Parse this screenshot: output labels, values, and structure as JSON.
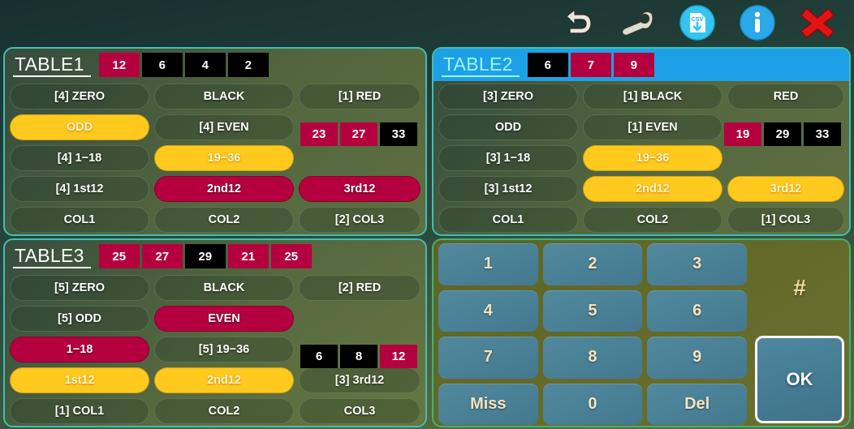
{
  "toolbar": {
    "buttons": [
      {
        "name": "undo-icon",
        "label": "Undo"
      },
      {
        "name": "wrench-icon",
        "label": "Settings"
      },
      {
        "name": "csv-export-icon",
        "label": "CSV",
        "badge": "CSV"
      },
      {
        "name": "info-icon",
        "label": "Info"
      },
      {
        "name": "close-icon",
        "label": "Close"
      }
    ]
  },
  "colors": {
    "red": "#b5003f",
    "black": "#000000",
    "yellow": "#ffc91e",
    "active_header": "#1ea0e6",
    "panel_border": "#3fbfb4",
    "key_blue": "#4a8298"
  },
  "tables": [
    {
      "id": "table1",
      "name": "TABLE1",
      "active": false,
      "history": [
        {
          "value": "12",
          "color": "red"
        },
        {
          "value": "6",
          "color": "black"
        },
        {
          "value": "4",
          "color": "black"
        },
        {
          "value": "2",
          "color": "black"
        }
      ],
      "side_chips": [
        {
          "value": "23",
          "color": "red"
        },
        {
          "value": "27",
          "color": "red"
        },
        {
          "value": "33",
          "color": "black"
        }
      ],
      "rows": [
        [
          {
            "label": "[4] ZERO",
            "state": "off"
          },
          {
            "label": "BLACK",
            "state": "off"
          },
          {
            "label": "[1] RED",
            "state": "off"
          }
        ],
        [
          {
            "label": "ODD",
            "state": "yellow"
          },
          {
            "label": "[4] EVEN",
            "state": "off"
          },
          {
            "label": "",
            "state": "blank"
          }
        ],
        [
          {
            "label": "[4] 1−18",
            "state": "off"
          },
          {
            "label": "19−36",
            "state": "yellow"
          },
          {
            "label": "",
            "state": "blank"
          }
        ],
        [
          {
            "label": "[4] 1st12",
            "state": "off"
          },
          {
            "label": "2nd12",
            "state": "red"
          },
          {
            "label": "3rd12",
            "state": "red"
          }
        ],
        [
          {
            "label": "COL1",
            "state": "off"
          },
          {
            "label": "COL2",
            "state": "off"
          },
          {
            "label": "[2] COL3",
            "state": "off"
          }
        ]
      ]
    },
    {
      "id": "table2",
      "name": "TABLE2",
      "active": true,
      "history": [
        {
          "value": "6",
          "color": "black"
        },
        {
          "value": "7",
          "color": "red"
        },
        {
          "value": "9",
          "color": "red"
        }
      ],
      "side_chips": [
        {
          "value": "19",
          "color": "red"
        },
        {
          "value": "29",
          "color": "black"
        },
        {
          "value": "33",
          "color": "black"
        }
      ],
      "rows": [
        [
          {
            "label": "[3] ZERO",
            "state": "off"
          },
          {
            "label": "[1] BLACK",
            "state": "off"
          },
          {
            "label": "RED",
            "state": "off"
          }
        ],
        [
          {
            "label": "ODD",
            "state": "off"
          },
          {
            "label": "[1] EVEN",
            "state": "off"
          },
          {
            "label": "",
            "state": "blank"
          }
        ],
        [
          {
            "label": "[3] 1−18",
            "state": "off"
          },
          {
            "label": "19−36",
            "state": "yellow"
          },
          {
            "label": "",
            "state": "blank"
          }
        ],
        [
          {
            "label": "[3] 1st12",
            "state": "off"
          },
          {
            "label": "2nd12",
            "state": "yellow"
          },
          {
            "label": "3rd12",
            "state": "yellow"
          }
        ],
        [
          {
            "label": "COL1",
            "state": "off"
          },
          {
            "label": "COL2",
            "state": "off"
          },
          {
            "label": "[1] COL3",
            "state": "off"
          }
        ]
      ]
    },
    {
      "id": "table3",
      "name": "TABLE3",
      "active": false,
      "history": [
        {
          "value": "25",
          "color": "red"
        },
        {
          "value": "27",
          "color": "red"
        },
        {
          "value": "29",
          "color": "black"
        },
        {
          "value": "21",
          "color": "red"
        },
        {
          "value": "25",
          "color": "red"
        }
      ],
      "side_chips": [
        {
          "value": "6",
          "color": "black"
        },
        {
          "value": "8",
          "color": "black"
        },
        {
          "value": "12",
          "color": "red"
        }
      ],
      "rows": [
        [
          {
            "label": "[5] ZERO",
            "state": "off"
          },
          {
            "label": "BLACK",
            "state": "off"
          },
          {
            "label": "[2] RED",
            "state": "off"
          }
        ],
        [
          {
            "label": "[5] ODD",
            "state": "off"
          },
          {
            "label": "EVEN",
            "state": "red"
          },
          {
            "label": "",
            "state": "blank"
          }
        ],
        [
          {
            "label": "1−18",
            "state": "red"
          },
          {
            "label": "[5] 19−36",
            "state": "off"
          },
          {
            "label": "",
            "state": "blank"
          }
        ],
        [
          {
            "label": "1st12",
            "state": "yellow"
          },
          {
            "label": "2nd12",
            "state": "yellow"
          },
          {
            "label": "[3] 3rd12",
            "state": "off"
          }
        ],
        [
          {
            "label": "[1] COL1",
            "state": "off"
          },
          {
            "label": "COL2",
            "state": "off"
          },
          {
            "label": "COL3",
            "state": "off"
          }
        ]
      ]
    }
  ],
  "keypad": {
    "keys": [
      "1",
      "2",
      "3",
      "4",
      "5",
      "6",
      "7",
      "8",
      "9",
      "Miss",
      "0",
      "Del"
    ],
    "display": "#",
    "ok_label": "OK"
  }
}
